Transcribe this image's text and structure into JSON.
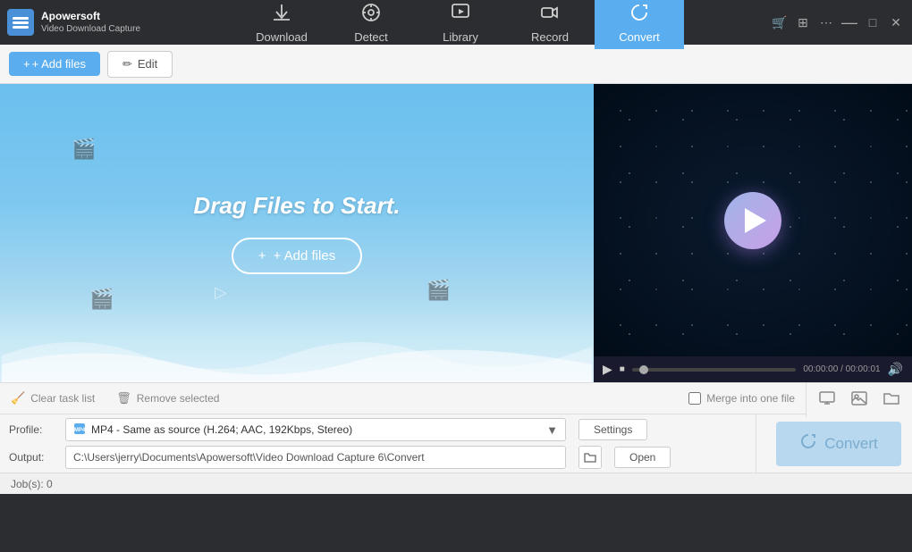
{
  "app": {
    "name": "Apowersoft",
    "subtitle": "Video Download Capture"
  },
  "nav": {
    "tabs": [
      {
        "id": "download",
        "label": "Download",
        "icon": "⬇",
        "active": false
      },
      {
        "id": "detect",
        "label": "Detect",
        "icon": "🎯",
        "active": false
      },
      {
        "id": "library",
        "label": "Library",
        "icon": "▶",
        "active": false
      },
      {
        "id": "record",
        "label": "Record",
        "icon": "🎥",
        "active": false
      },
      {
        "id": "convert",
        "label": "Convert",
        "icon": "🔄",
        "active": true
      }
    ]
  },
  "window_controls": {
    "cart": "🛒",
    "grid": "⊞",
    "more": "⋯",
    "minimize": "—",
    "restore": "□",
    "close": "✕"
  },
  "toolbar": {
    "add_files_label": "+ Add files",
    "edit_label": "✏ Edit"
  },
  "drop_zone": {
    "drag_text": "Drag Files to Start.",
    "add_btn": "+ Add files"
  },
  "video_controls": {
    "play_icon": "▶",
    "stop_icon": "■",
    "time": "00:00:00 / 00:00:01",
    "volume_icon": "🔊"
  },
  "bottom_actions": {
    "clear": "Clear task list",
    "remove": "Remove selected",
    "merge_label": "Merge into one file"
  },
  "preview_icons": {
    "screen": "🖥",
    "image": "🖼",
    "folder": "📁"
  },
  "profile_row": {
    "label": "Profile:",
    "value": "MP4 - Same as source (H.264; AAC, 192Kbps, Stereo)",
    "settings_btn": "Settings"
  },
  "output_row": {
    "label": "Output:",
    "path": "C:\\Users\\jerry\\Documents\\Apowersoft\\Video Download Capture 6\\Convert",
    "open_btn": "Open"
  },
  "convert_btn": {
    "label": "Convert",
    "icon": "🔄"
  },
  "status_bar": {
    "text": "Job(s): 0"
  }
}
